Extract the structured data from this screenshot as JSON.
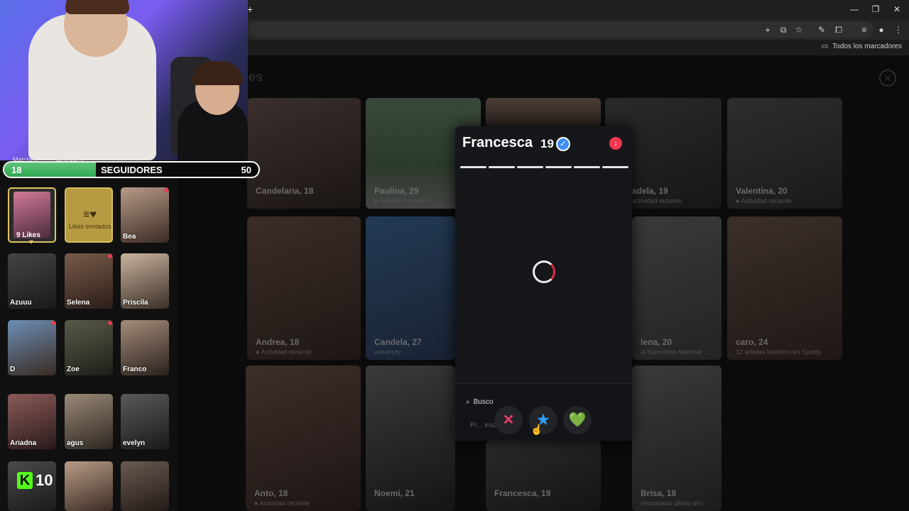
{
  "browser": {
    "new_tab": "+",
    "bookmarks_label": "Todos los marcadores",
    "window": {
      "minimize": "—",
      "maximize": "❐",
      "close": "✕"
    }
  },
  "app": {
    "title": "es",
    "close": "✕",
    "cards": [
      {
        "name": "Candelaria, 18",
        "sub": ""
      },
      {
        "name": "Paulina, 29",
        "sub": "● Actividad reciente"
      },
      {
        "name": "",
        "sub": ""
      },
      {
        "name": "adela, 19",
        "sub": "actividad reciente"
      },
      {
        "name": "Valentina, 20",
        "sub": "● Actividad reciente"
      },
      {
        "name": "Andrea, 18",
        "sub": "● Actividad reciente"
      },
      {
        "name": "Candela, 27",
        "sub": "university"
      },
      {
        "name": "lena, 20",
        "sub": "al Sarmiento National ..."
      },
      {
        "name": "caro, 24",
        "sub": "12 artistas favoritos en Spotify"
      },
      {
        "name": "Anto, 18",
        "sub": "● Actividad reciente"
      },
      {
        "name": "Noemi, 21",
        "sub": ""
      },
      {
        "name": "Francesca, 19",
        "sub": ""
      },
      {
        "name": "Brisa, 18",
        "sub": "secundaria último año"
      }
    ]
  },
  "modal": {
    "name": "Francesca",
    "age": "19",
    "search_label": "Busco",
    "pref_text": "Pr... esc...",
    "actions": {
      "nope": "✕",
      "superlike": "★",
      "like": "💚"
    }
  },
  "stream": {
    "tabs": [
      "Matches",
      "Mensajes"
    ],
    "followers": {
      "current": "18",
      "label": "SEGUIDORES",
      "goal": "50",
      "progress": 0.36
    },
    "kick_count": "10",
    "tiles": [
      {
        "label": "9 Likes",
        "dot": false
      },
      {
        "label": "Likes enviados",
        "dot": false
      },
      {
        "label": "Bea",
        "dot": true
      },
      {
        "label": "Azuuu",
        "dot": false
      },
      {
        "label": "Selena",
        "dot": true
      },
      {
        "label": "Priscila",
        "dot": false
      },
      {
        "label": "D",
        "dot": true
      },
      {
        "label": "Zoe",
        "dot": true
      },
      {
        "label": "Franco",
        "dot": false
      },
      {
        "label": "Ariadna",
        "dot": false
      },
      {
        "label": "agus",
        "dot": false
      },
      {
        "label": "evelyn",
        "dot": false
      }
    ]
  }
}
